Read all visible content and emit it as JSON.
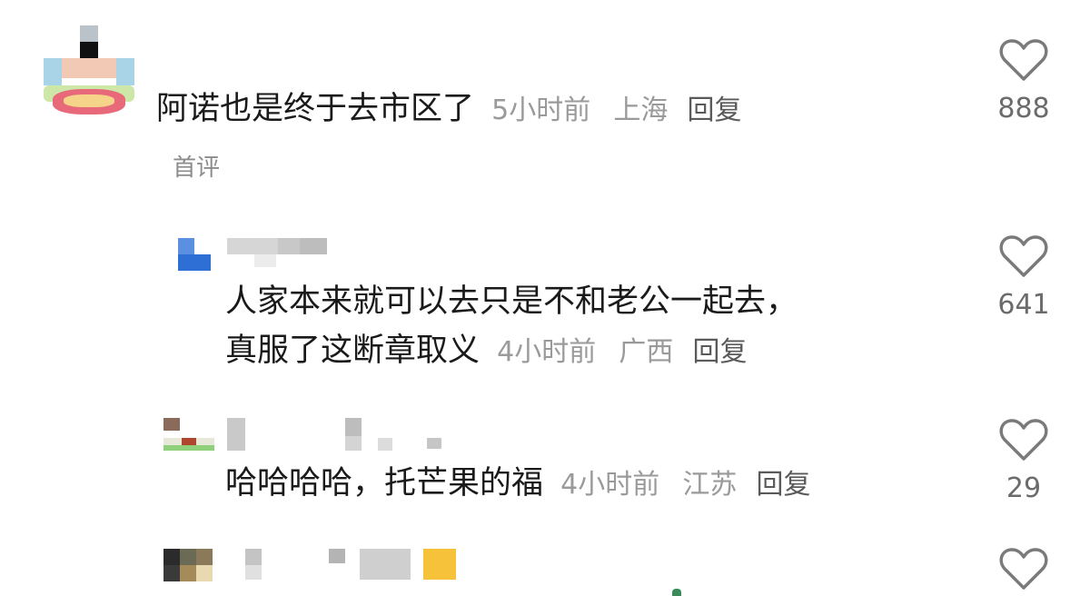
{
  "comments": [
    {
      "text": "阿诺也是终于去市区了",
      "time": "5小时前",
      "location": "上海",
      "reply_label": "回复",
      "tag": "首评",
      "likes": "888"
    },
    {
      "text_line1": "人家本来就可以去只是不和老公一起去，",
      "text_line2": "真服了这断章取义",
      "time": "4小时前",
      "location": "广西",
      "reply_label": "回复",
      "likes": "641"
    },
    {
      "text": "哈哈哈哈，托芒果的福",
      "time": "4小时前",
      "location": "江苏",
      "reply_label": "回复",
      "likes": "29"
    }
  ],
  "colors": {
    "text": "#1a1a1a",
    "meta": "#9a9a9a",
    "reply": "#5a5a5a",
    "heart": "#7a7a7a"
  },
  "icons": {
    "like": "heart-outline-icon"
  }
}
